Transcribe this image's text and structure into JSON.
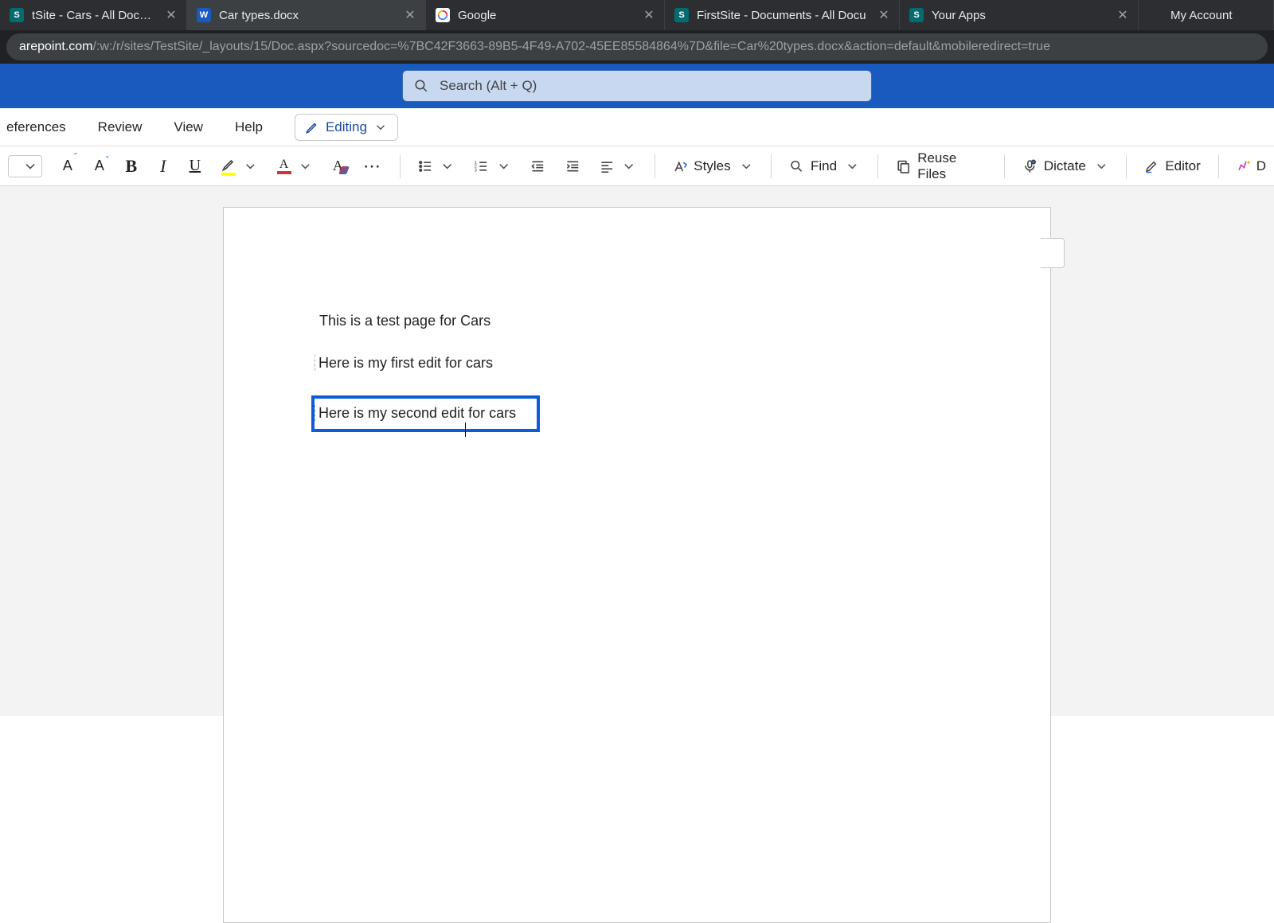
{
  "browser": {
    "tabs": [
      {
        "title": "tSite - Cars - All Documents",
        "icon": "sharepoint",
        "active": false,
        "closeable": true
      },
      {
        "title": "Car types.docx",
        "icon": "word",
        "active": true,
        "closeable": true
      },
      {
        "title": "Google",
        "icon": "google",
        "active": false,
        "closeable": true
      },
      {
        "title": "FirstSite - Documents - All Docu",
        "icon": "sharepoint",
        "active": false,
        "closeable": true
      },
      {
        "title": "Your Apps",
        "icon": "sharepoint",
        "active": false,
        "closeable": true
      },
      {
        "title": "My Account",
        "icon": "microsoft",
        "active": false,
        "closeable": false
      }
    ],
    "url_host": "arepoint.com",
    "url_path": "/:w:/r/sites/TestSite/_layouts/15/Doc.aspx?sourcedoc=%7BC42F3663-89B5-4F49-A702-45EE85584864%7D&file=Car%20types.docx&action=default&mobileredirect=true"
  },
  "word": {
    "search_placeholder": "Search (Alt + Q)",
    "ribbon_tabs": [
      "eferences",
      "Review",
      "View",
      "Help"
    ],
    "editing_mode": "Editing",
    "toolbar": {
      "styles": "Styles",
      "find": "Find",
      "reuse": "Reuse Files",
      "dictate": "Dictate",
      "editor": "Editor"
    }
  },
  "document": {
    "line1": "This is a test page for Cars",
    "line2": "Here is my first edit for cars",
    "line3": "Here is my second edit for cars"
  }
}
